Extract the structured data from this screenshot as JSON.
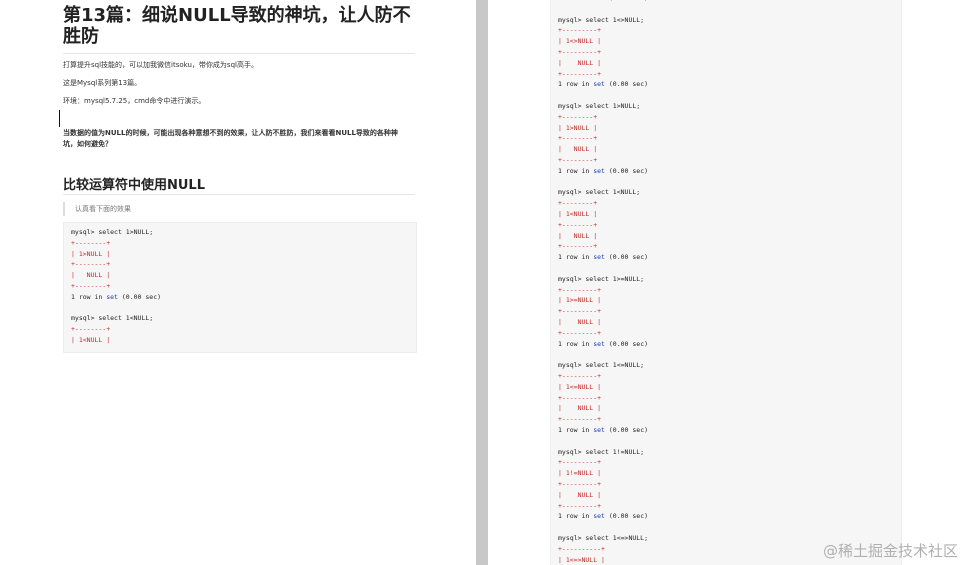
{
  "article": {
    "title": "第13篇：细说NULL导致的神坑，让人防不胜防",
    "intro1": "打算提升sql技能的，可以加我微信itsoku，带你成为sql高手。",
    "intro2": "这是Mysql系列第13篇。",
    "intro3": "环境：mysql5.7.25，cmd命令中进行演示。",
    "bold_para": "当数据的值为NULL的时候，可能出现各种意想不到的效果，让人防不胜防，我们来看看NULL导致的各种神坑，如何避免？",
    "section_heading": "比较运算符中使用NULL",
    "quote": "认真看下面的效果"
  },
  "code": {
    "left_lines": [
      {
        "t": "prompt",
        "text": "mysql> select 1>NULL;"
      },
      {
        "t": "border",
        "text": "+--------+"
      },
      {
        "t": "border",
        "text": "| 1>NULL |"
      },
      {
        "t": "border",
        "text": "+--------+"
      },
      {
        "t": "border",
        "text": "|   NULL |"
      },
      {
        "t": "border",
        "text": "+--------+"
      },
      {
        "t": "row",
        "a": "1 row in ",
        "k": "set",
        "b": " (0.00 sec)"
      },
      {
        "t": "blank",
        "text": ""
      },
      {
        "t": "prompt",
        "text": "mysql> select 1<NULL;"
      },
      {
        "t": "border",
        "text": "+--------+"
      },
      {
        "t": "border",
        "text": "| 1<NULL |"
      }
    ],
    "right_lines": [
      {
        "t": "row",
        "a": "1 row in ",
        "k": "set",
        "b": " (0.00 sec)"
      },
      {
        "t": "blank",
        "text": ""
      },
      {
        "t": "prompt",
        "text": "mysql> select 1<>NULL;"
      },
      {
        "t": "border",
        "text": "+---------+"
      },
      {
        "t": "border",
        "text": "| 1<>NULL |"
      },
      {
        "t": "border",
        "text": "+---------+"
      },
      {
        "t": "border",
        "text": "|    NULL |"
      },
      {
        "t": "border",
        "text": "+---------+"
      },
      {
        "t": "row",
        "a": "1 row in ",
        "k": "set",
        "b": " (0.00 sec)"
      },
      {
        "t": "blank",
        "text": ""
      },
      {
        "t": "prompt",
        "text": "mysql> select 1>NULL;"
      },
      {
        "t": "border",
        "text": "+--------+"
      },
      {
        "t": "border",
        "text": "| 1>NULL |"
      },
      {
        "t": "border",
        "text": "+--------+"
      },
      {
        "t": "border",
        "text": "|   NULL |"
      },
      {
        "t": "border",
        "text": "+--------+"
      },
      {
        "t": "row",
        "a": "1 row in ",
        "k": "set",
        "b": " (0.00 sec)"
      },
      {
        "t": "blank",
        "text": ""
      },
      {
        "t": "prompt",
        "text": "mysql> select 1<NULL;"
      },
      {
        "t": "border",
        "text": "+--------+"
      },
      {
        "t": "border",
        "text": "| 1<NULL |"
      },
      {
        "t": "border",
        "text": "+--------+"
      },
      {
        "t": "border",
        "text": "|   NULL |"
      },
      {
        "t": "border",
        "text": "+--------+"
      },
      {
        "t": "row",
        "a": "1 row in ",
        "k": "set",
        "b": " (0.00 sec)"
      },
      {
        "t": "blank",
        "text": ""
      },
      {
        "t": "prompt",
        "text": "mysql> select 1>=NULL;"
      },
      {
        "t": "border",
        "text": "+---------+"
      },
      {
        "t": "border",
        "text": "| 1>=NULL |"
      },
      {
        "t": "border",
        "text": "+---------+"
      },
      {
        "t": "border",
        "text": "|    NULL |"
      },
      {
        "t": "border",
        "text": "+---------+"
      },
      {
        "t": "row",
        "a": "1 row in ",
        "k": "set",
        "b": " (0.00 sec)"
      },
      {
        "t": "blank",
        "text": ""
      },
      {
        "t": "prompt",
        "text": "mysql> select 1<=NULL;"
      },
      {
        "t": "border",
        "text": "+---------+"
      },
      {
        "t": "border",
        "text": "| 1<=NULL |"
      },
      {
        "t": "border",
        "text": "+---------+"
      },
      {
        "t": "border",
        "text": "|    NULL |"
      },
      {
        "t": "border",
        "text": "+---------+"
      },
      {
        "t": "row",
        "a": "1 row in ",
        "k": "set",
        "b": " (0.00 sec)"
      },
      {
        "t": "blank",
        "text": ""
      },
      {
        "t": "prompt",
        "text": "mysql> select 1!=NULL;"
      },
      {
        "t": "border",
        "text": "+---------+"
      },
      {
        "t": "border",
        "text": "| 1!=NULL |"
      },
      {
        "t": "border",
        "text": "+---------+"
      },
      {
        "t": "border",
        "text": "|    NULL |"
      },
      {
        "t": "border",
        "text": "+---------+"
      },
      {
        "t": "row",
        "a": "1 row in ",
        "k": "set",
        "b": " (0.00 sec)"
      },
      {
        "t": "blank",
        "text": ""
      },
      {
        "t": "prompt",
        "text": "mysql> select 1<=>NULL;"
      },
      {
        "t": "border",
        "text": "+----------+"
      },
      {
        "t": "border",
        "text": "| 1<=>NULL |"
      }
    ]
  },
  "watermark": "@稀土掘金技术社区",
  "colors": {
    "border": "#c62828",
    "keyword": "#1e3bb3",
    "gutter": "#c8c8c8"
  }
}
